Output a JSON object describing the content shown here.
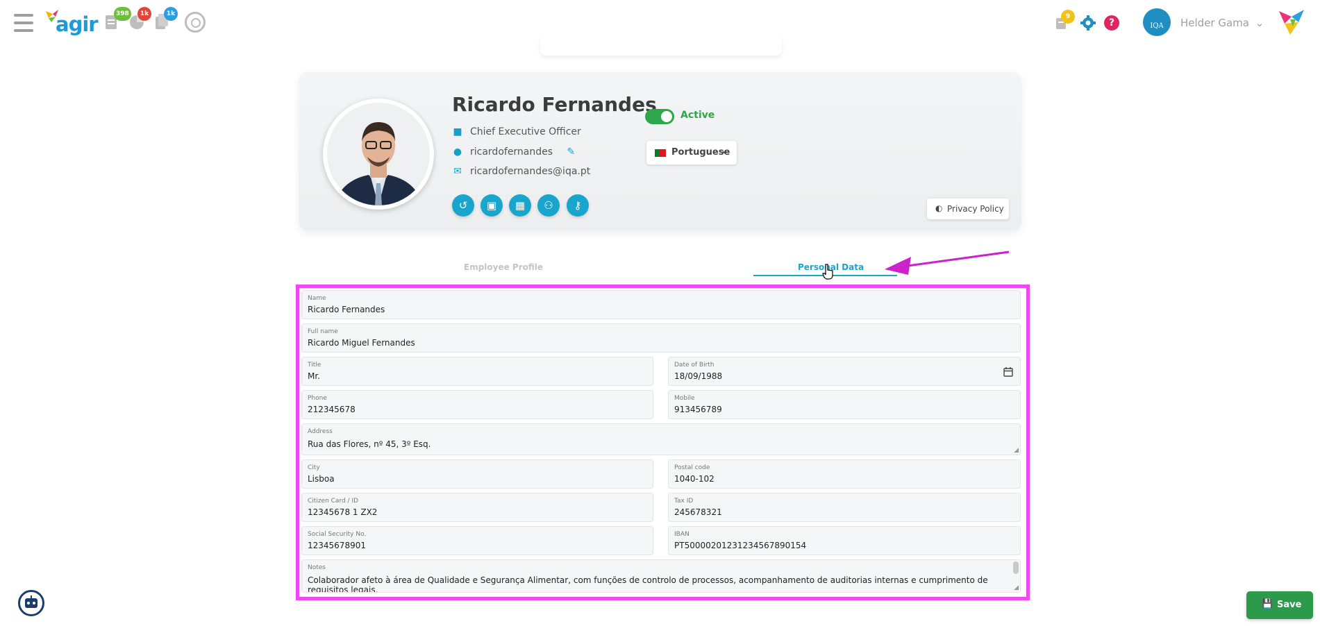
{
  "topbar": {
    "logo_text": "agir",
    "badges": [
      {
        "icon": "documents-icon",
        "count": "398",
        "color": "#6cbf3a"
      },
      {
        "icon": "pie-chart-icon",
        "count": "1k",
        "color": "#e0453a"
      },
      {
        "icon": "tasks-icon",
        "count": "1k",
        "color": "#2b9fe0"
      }
    ],
    "notification_count": "9",
    "notification_color": "#f2c21b",
    "user_name": "Helder Gama",
    "user_avatar_text": "IQA"
  },
  "profile": {
    "name": "Ricardo Fernandes",
    "job_title": "Chief Executive Officer",
    "username": "ricardofernandes",
    "email": "ricardofernandes@iqa.pt",
    "status_label": "Active",
    "language": "Portuguese",
    "privacy_label": "Privacy Policy",
    "actions": [
      "history-icon",
      "briefcase-icon",
      "building-icon",
      "team-icon",
      "user-key-icon"
    ]
  },
  "tabs": [
    {
      "label": "Employee Profile",
      "active": false
    },
    {
      "label": "Personal Data",
      "active": true
    }
  ],
  "form": {
    "name": {
      "label": "Name",
      "value": "Ricardo Fernandes"
    },
    "full_name": {
      "label": "Full name",
      "value": "Ricardo Miguel Fernandes"
    },
    "title": {
      "label": "Title",
      "value": "Mr."
    },
    "date_of_birth": {
      "label": "Date of Birth",
      "value": "18/09/1988"
    },
    "phone": {
      "label": "Phone",
      "value": "212345678"
    },
    "mobile": {
      "label": "Mobile",
      "value": "913456789"
    },
    "address": {
      "label": "Address",
      "value": "Rua das Flores, nº 45, 3º Esq."
    },
    "city": {
      "label": "City",
      "value": "Lisboa"
    },
    "postal_code": {
      "label": "Postal code",
      "value": "1040-102"
    },
    "citizen_card": {
      "label": "Citizen Card / ID",
      "value": "12345678 1 ZX2"
    },
    "tax_id": {
      "label": "Tax ID",
      "value": "245678321"
    },
    "social_security": {
      "label": "Social Security No.",
      "value": "12345678901"
    },
    "iban": {
      "label": "IBAN",
      "value": "PT50000201231234567890154"
    },
    "notes": {
      "label": "Notes",
      "value": "Colaborador afeto à área de Qualidade e Segurança Alimentar, com funções de controlo de processos, acompanhamento de auditorias internas e cumprimento de requisitos legais."
    }
  },
  "save_label": "Save",
  "colors": {
    "accent": "#1aa6cc",
    "success": "#2ea64a",
    "annotation": "#ee48ee"
  }
}
